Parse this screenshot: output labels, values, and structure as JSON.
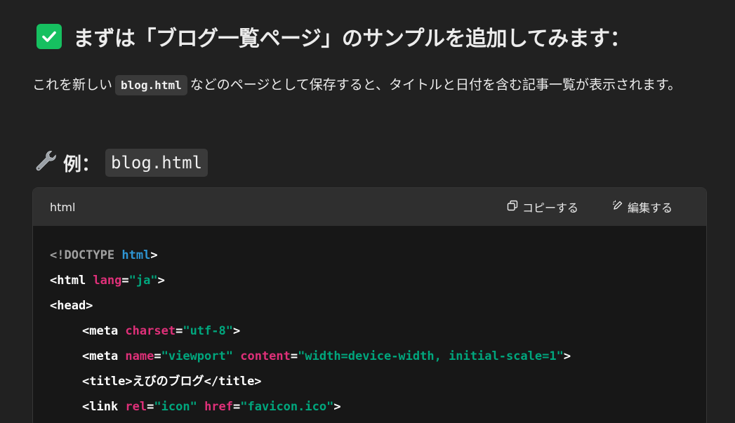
{
  "heading": {
    "text": "まずは「ブログ一覧ページ」のサンプルを追加してみます："
  },
  "paragraph": {
    "before": "これを新しい",
    "code": "blog.html",
    "after": "などのページとして保存すると、タイトルと日付を含む記事一覧が表示されます。"
  },
  "example_heading": {
    "label": "例：",
    "code": "blog.html"
  },
  "code_block": {
    "language": "html",
    "copy_label": "コピーする",
    "edit_label": "編集する",
    "lines": {
      "l1": {
        "open": "<!DOCTYPE ",
        "kw": "html",
        "close": ">"
      },
      "l2": {
        "tag": "<html ",
        "attr": "lang",
        "eq": "=",
        "val": "\"ja\"",
        "close": ">"
      },
      "l3": {
        "tag": "<head>"
      },
      "l4": {
        "tag": "<meta ",
        "attr": "charset",
        "eq": "=",
        "val": "\"utf-8\"",
        "close": ">"
      },
      "l5": {
        "tag": "<meta ",
        "attr1": "name",
        "eq1": "=",
        "val1": "\"viewport\"",
        "sp": " ",
        "attr2": "content",
        "eq2": "=",
        "val2": "\"width=device-width, initial-scale=1\"",
        "close": ">"
      },
      "l6": {
        "open": "<title>",
        "text": "えびのブログ",
        "close": "</title>"
      },
      "l7": {
        "tag": "<link ",
        "attr1": "rel",
        "eq1": "=",
        "val1": "\"icon\"",
        "sp": " ",
        "attr2": "href",
        "eq2": "=",
        "val2": "\"favicon.ico\"",
        "close": ">"
      }
    }
  },
  "colors": {
    "background": "#212121",
    "code_background": "#171717",
    "header_background": "#2f2f2f",
    "check_green": "#16c060",
    "tag_gray": "#a0a0a0",
    "keyword_blue": "#2e95d3",
    "attr_pink": "#df3079",
    "string_green": "#00a67d"
  },
  "icons": {
    "heading_icon": "check-mark-button-icon",
    "example_icon": "wrench-icon",
    "copy_icon": "copy-icon",
    "edit_icon": "pencil-icon"
  }
}
